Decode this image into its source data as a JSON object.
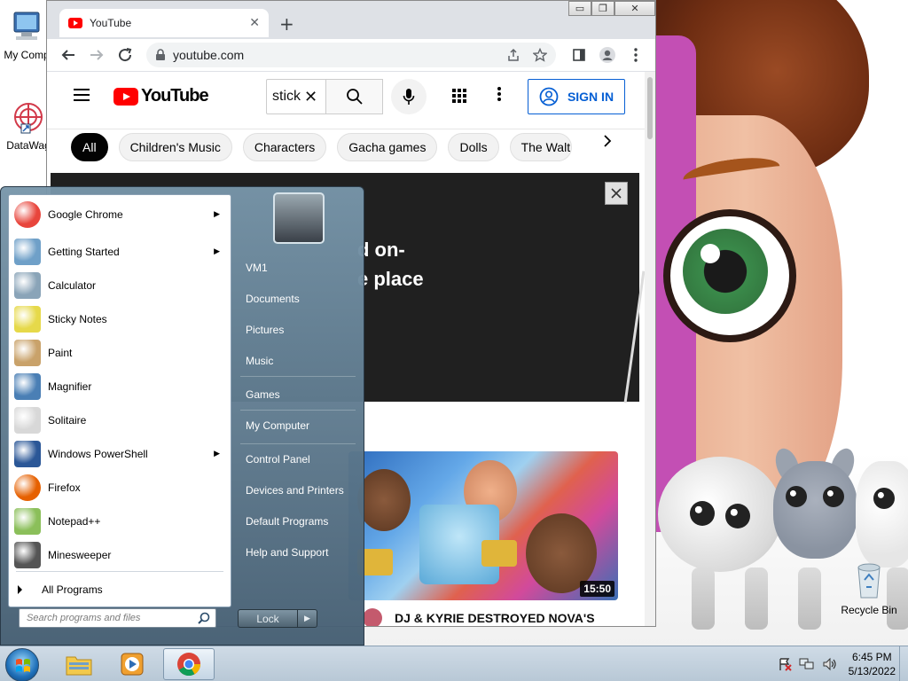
{
  "desktop": {
    "icons": [
      {
        "label": "My Comp"
      },
      {
        "label": "DataWag"
      }
    ],
    "recycle_bin": "Recycle Bin"
  },
  "browser": {
    "tab_title": "YouTube",
    "new_tab": "+",
    "url": "youtube.com",
    "window_controls": {
      "minimize": "▭",
      "restore": "❐",
      "close": "✕"
    }
  },
  "youtube": {
    "logo_text": "YouTube",
    "search_value": "stick",
    "sign_in": "SIGN IN",
    "chips": [
      "All",
      "Children's Music",
      "Characters",
      "Gacha games",
      "Dolls",
      "The Walt"
    ],
    "ad_text_line1": "d on-",
    "ad_text_line2": "e place",
    "video": {
      "duration": "15:50",
      "title": "DJ & KYRIE DESTROYED NOVA'S"
    }
  },
  "start_menu": {
    "programs": [
      {
        "label": "Google Chrome",
        "submenu": true,
        "icon": "chrome-icon",
        "color": "#e8453c"
      },
      {
        "label": "Getting Started",
        "submenu": true,
        "icon": "getting-started-icon",
        "color": "#6fa0c8"
      },
      {
        "label": "Calculator",
        "submenu": false,
        "icon": "calculator-icon",
        "color": "#8aa4b8"
      },
      {
        "label": "Sticky Notes",
        "submenu": false,
        "icon": "sticky-notes-icon",
        "color": "#e6d94a"
      },
      {
        "label": "Paint",
        "submenu": false,
        "icon": "paint-icon",
        "color": "#c9a26a"
      },
      {
        "label": "Magnifier",
        "submenu": false,
        "icon": "magnifier-icon",
        "color": "#4a7fb5"
      },
      {
        "label": "Solitaire",
        "submenu": false,
        "icon": "solitaire-icon",
        "color": "#d8d8d8"
      },
      {
        "label": "Windows PowerShell",
        "submenu": true,
        "icon": "powershell-icon",
        "color": "#2b5797"
      },
      {
        "label": "Firefox",
        "submenu": false,
        "icon": "firefox-icon",
        "color": "#e66000"
      },
      {
        "label": "Notepad++",
        "submenu": false,
        "icon": "notepad-plus-plus-icon",
        "color": "#8bbf5a"
      },
      {
        "label": "Minesweeper",
        "submenu": false,
        "icon": "minesweeper-icon",
        "color": "#555555"
      }
    ],
    "all_programs": "All Programs",
    "search_placeholder": "Search programs and files",
    "right_items": [
      "VM1",
      "Documents",
      "Pictures",
      "Music",
      "Games",
      "My Computer",
      "Control Panel",
      "Devices and Printers",
      "Default Programs",
      "Help and Support"
    ],
    "lock_label": "Lock"
  },
  "taskbar": {
    "time": "6:45 PM",
    "date": "5/13/2022"
  }
}
